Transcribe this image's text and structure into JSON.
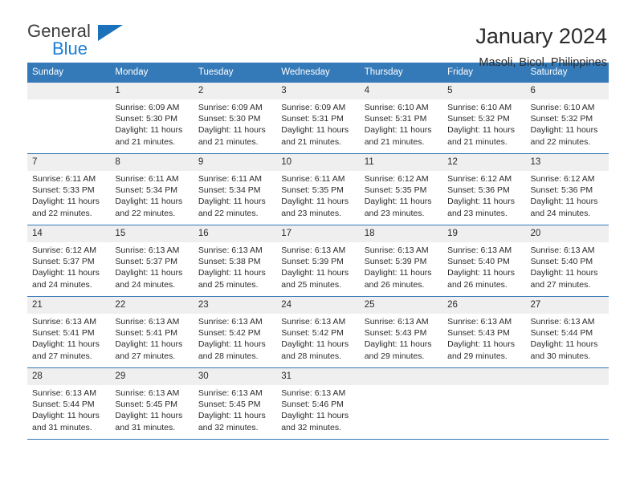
{
  "brand": {
    "name_top": "General",
    "name_bottom": "Blue",
    "triangle_icon": "brand-triangle-icon",
    "color_dark": "#3c3c3c",
    "color_blue": "#1b7fd4"
  },
  "header": {
    "title": "January 2024",
    "subtitle": "Masoli, Bicol, Philippines"
  },
  "theme": {
    "header_blue": "#3479b8",
    "daynum_gray": "#efefef",
    "text": "#2b2b2b"
  },
  "weekday_headers": [
    "Sunday",
    "Monday",
    "Tuesday",
    "Wednesday",
    "Thursday",
    "Friday",
    "Saturday"
  ],
  "weeks": [
    [
      {
        "day": "",
        "sunrise": "",
        "sunset": "",
        "daylight_line1": "",
        "daylight_line2": ""
      },
      {
        "day": "1",
        "sunrise": "Sunrise: 6:09 AM",
        "sunset": "Sunset: 5:30 PM",
        "daylight_line1": "Daylight: 11 hours",
        "daylight_line2": "and 21 minutes."
      },
      {
        "day": "2",
        "sunrise": "Sunrise: 6:09 AM",
        "sunset": "Sunset: 5:30 PM",
        "daylight_line1": "Daylight: 11 hours",
        "daylight_line2": "and 21 minutes."
      },
      {
        "day": "3",
        "sunrise": "Sunrise: 6:09 AM",
        "sunset": "Sunset: 5:31 PM",
        "daylight_line1": "Daylight: 11 hours",
        "daylight_line2": "and 21 minutes."
      },
      {
        "day": "4",
        "sunrise": "Sunrise: 6:10 AM",
        "sunset": "Sunset: 5:31 PM",
        "daylight_line1": "Daylight: 11 hours",
        "daylight_line2": "and 21 minutes."
      },
      {
        "day": "5",
        "sunrise": "Sunrise: 6:10 AM",
        "sunset": "Sunset: 5:32 PM",
        "daylight_line1": "Daylight: 11 hours",
        "daylight_line2": "and 21 minutes."
      },
      {
        "day": "6",
        "sunrise": "Sunrise: 6:10 AM",
        "sunset": "Sunset: 5:32 PM",
        "daylight_line1": "Daylight: 11 hours",
        "daylight_line2": "and 22 minutes."
      }
    ],
    [
      {
        "day": "7",
        "sunrise": "Sunrise: 6:11 AM",
        "sunset": "Sunset: 5:33 PM",
        "daylight_line1": "Daylight: 11 hours",
        "daylight_line2": "and 22 minutes."
      },
      {
        "day": "8",
        "sunrise": "Sunrise: 6:11 AM",
        "sunset": "Sunset: 5:34 PM",
        "daylight_line1": "Daylight: 11 hours",
        "daylight_line2": "and 22 minutes."
      },
      {
        "day": "9",
        "sunrise": "Sunrise: 6:11 AM",
        "sunset": "Sunset: 5:34 PM",
        "daylight_line1": "Daylight: 11 hours",
        "daylight_line2": "and 22 minutes."
      },
      {
        "day": "10",
        "sunrise": "Sunrise: 6:11 AM",
        "sunset": "Sunset: 5:35 PM",
        "daylight_line1": "Daylight: 11 hours",
        "daylight_line2": "and 23 minutes."
      },
      {
        "day": "11",
        "sunrise": "Sunrise: 6:12 AM",
        "sunset": "Sunset: 5:35 PM",
        "daylight_line1": "Daylight: 11 hours",
        "daylight_line2": "and 23 minutes."
      },
      {
        "day": "12",
        "sunrise": "Sunrise: 6:12 AM",
        "sunset": "Sunset: 5:36 PM",
        "daylight_line1": "Daylight: 11 hours",
        "daylight_line2": "and 23 minutes."
      },
      {
        "day": "13",
        "sunrise": "Sunrise: 6:12 AM",
        "sunset": "Sunset: 5:36 PM",
        "daylight_line1": "Daylight: 11 hours",
        "daylight_line2": "and 24 minutes."
      }
    ],
    [
      {
        "day": "14",
        "sunrise": "Sunrise: 6:12 AM",
        "sunset": "Sunset: 5:37 PM",
        "daylight_line1": "Daylight: 11 hours",
        "daylight_line2": "and 24 minutes."
      },
      {
        "day": "15",
        "sunrise": "Sunrise: 6:13 AM",
        "sunset": "Sunset: 5:37 PM",
        "daylight_line1": "Daylight: 11 hours",
        "daylight_line2": "and 24 minutes."
      },
      {
        "day": "16",
        "sunrise": "Sunrise: 6:13 AM",
        "sunset": "Sunset: 5:38 PM",
        "daylight_line1": "Daylight: 11 hours",
        "daylight_line2": "and 25 minutes."
      },
      {
        "day": "17",
        "sunrise": "Sunrise: 6:13 AM",
        "sunset": "Sunset: 5:39 PM",
        "daylight_line1": "Daylight: 11 hours",
        "daylight_line2": "and 25 minutes."
      },
      {
        "day": "18",
        "sunrise": "Sunrise: 6:13 AM",
        "sunset": "Sunset: 5:39 PM",
        "daylight_line1": "Daylight: 11 hours",
        "daylight_line2": "and 26 minutes."
      },
      {
        "day": "19",
        "sunrise": "Sunrise: 6:13 AM",
        "sunset": "Sunset: 5:40 PM",
        "daylight_line1": "Daylight: 11 hours",
        "daylight_line2": "and 26 minutes."
      },
      {
        "day": "20",
        "sunrise": "Sunrise: 6:13 AM",
        "sunset": "Sunset: 5:40 PM",
        "daylight_line1": "Daylight: 11 hours",
        "daylight_line2": "and 27 minutes."
      }
    ],
    [
      {
        "day": "21",
        "sunrise": "Sunrise: 6:13 AM",
        "sunset": "Sunset: 5:41 PM",
        "daylight_line1": "Daylight: 11 hours",
        "daylight_line2": "and 27 minutes."
      },
      {
        "day": "22",
        "sunrise": "Sunrise: 6:13 AM",
        "sunset": "Sunset: 5:41 PM",
        "daylight_line1": "Daylight: 11 hours",
        "daylight_line2": "and 27 minutes."
      },
      {
        "day": "23",
        "sunrise": "Sunrise: 6:13 AM",
        "sunset": "Sunset: 5:42 PM",
        "daylight_line1": "Daylight: 11 hours",
        "daylight_line2": "and 28 minutes."
      },
      {
        "day": "24",
        "sunrise": "Sunrise: 6:13 AM",
        "sunset": "Sunset: 5:42 PM",
        "daylight_line1": "Daylight: 11 hours",
        "daylight_line2": "and 28 minutes."
      },
      {
        "day": "25",
        "sunrise": "Sunrise: 6:13 AM",
        "sunset": "Sunset: 5:43 PM",
        "daylight_line1": "Daylight: 11 hours",
        "daylight_line2": "and 29 minutes."
      },
      {
        "day": "26",
        "sunrise": "Sunrise: 6:13 AM",
        "sunset": "Sunset: 5:43 PM",
        "daylight_line1": "Daylight: 11 hours",
        "daylight_line2": "and 29 minutes."
      },
      {
        "day": "27",
        "sunrise": "Sunrise: 6:13 AM",
        "sunset": "Sunset: 5:44 PM",
        "daylight_line1": "Daylight: 11 hours",
        "daylight_line2": "and 30 minutes."
      }
    ],
    [
      {
        "day": "28",
        "sunrise": "Sunrise: 6:13 AM",
        "sunset": "Sunset: 5:44 PM",
        "daylight_line1": "Daylight: 11 hours",
        "daylight_line2": "and 31 minutes."
      },
      {
        "day": "29",
        "sunrise": "Sunrise: 6:13 AM",
        "sunset": "Sunset: 5:45 PM",
        "daylight_line1": "Daylight: 11 hours",
        "daylight_line2": "and 31 minutes."
      },
      {
        "day": "30",
        "sunrise": "Sunrise: 6:13 AM",
        "sunset": "Sunset: 5:45 PM",
        "daylight_line1": "Daylight: 11 hours",
        "daylight_line2": "and 32 minutes."
      },
      {
        "day": "31",
        "sunrise": "Sunrise: 6:13 AM",
        "sunset": "Sunset: 5:46 PM",
        "daylight_line1": "Daylight: 11 hours",
        "daylight_line2": "and 32 minutes."
      },
      {
        "day": "",
        "sunrise": "",
        "sunset": "",
        "daylight_line1": "",
        "daylight_line2": ""
      },
      {
        "day": "",
        "sunrise": "",
        "sunset": "",
        "daylight_line1": "",
        "daylight_line2": ""
      },
      {
        "day": "",
        "sunrise": "",
        "sunset": "",
        "daylight_line1": "",
        "daylight_line2": ""
      }
    ]
  ]
}
